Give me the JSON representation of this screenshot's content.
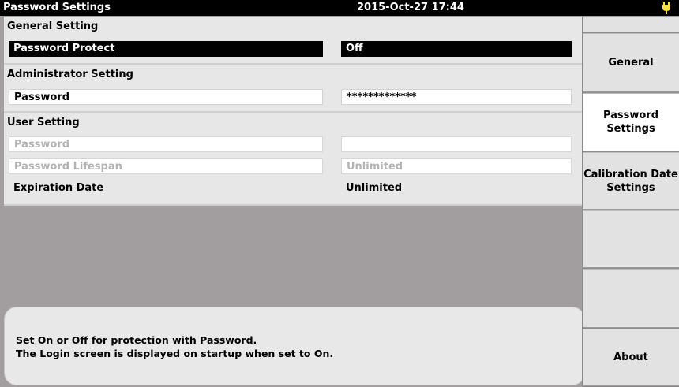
{
  "header": {
    "title": "Password Settings",
    "datetime": "2015-Oct-27 17:44",
    "power_icon": "battery-plug-icon",
    "power_color": "#f5e04a"
  },
  "general": {
    "title": "General Setting",
    "password_protect_label": "Password Protect",
    "password_protect_value": "Off"
  },
  "admin": {
    "title": "Administrator Setting",
    "password_label": "Password",
    "password_value": "*************"
  },
  "user": {
    "title": "User Setting",
    "password_label": "Password",
    "password_value": "",
    "lifespan_label": "Password Lifespan",
    "lifespan_value": "Unlimited",
    "expiration_label": "Expiration Date",
    "expiration_value": "Unlimited"
  },
  "help": {
    "line1": "Set On or Off for protection with Password.",
    "line2": "The Login screen is displayed on startup when set to On."
  },
  "softkeys": {
    "general": "General",
    "password_settings_1": "Password",
    "password_settings_2": "Settings",
    "calibration_1": "Calibration Date",
    "calibration_2": "Settings",
    "empty_1": "",
    "empty_2": "",
    "about": "About"
  }
}
